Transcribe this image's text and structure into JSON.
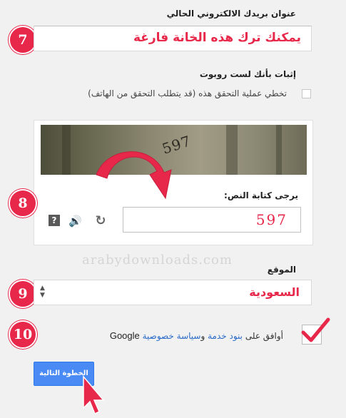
{
  "email": {
    "label": "عنوان بريدك الالكتروني الحالي",
    "hint": "يمكنك ترك هذه الخانة فارغة",
    "step": "7"
  },
  "robot": {
    "title": "إثبات بأنك لست روبوت",
    "skip_label": "تخطي عملية التحقق هذه (قد يتطلب التحقق من الهاتف)"
  },
  "captcha": {
    "image_text": "597",
    "prompt": "يرجى كتابة النص:",
    "input_value": "597",
    "step": "8",
    "icons": [
      "help-icon",
      "audio-icon",
      "refresh-icon"
    ]
  },
  "watermark": "arabydownloads.com",
  "location": {
    "label": "الموقع",
    "value": "السعودية",
    "step": "9"
  },
  "terms": {
    "prefix": "أوافق على",
    "tos_link": "بنود خدمة",
    "and": "و",
    "privacy_link": "سياسة خصوصية",
    "brand": "Google",
    "step": "10",
    "checked": true
  },
  "next_button": "الخطوة التالية",
  "colors": {
    "accent": "#e8284a",
    "button": "#4a8af4",
    "link": "#2a6ac9"
  }
}
